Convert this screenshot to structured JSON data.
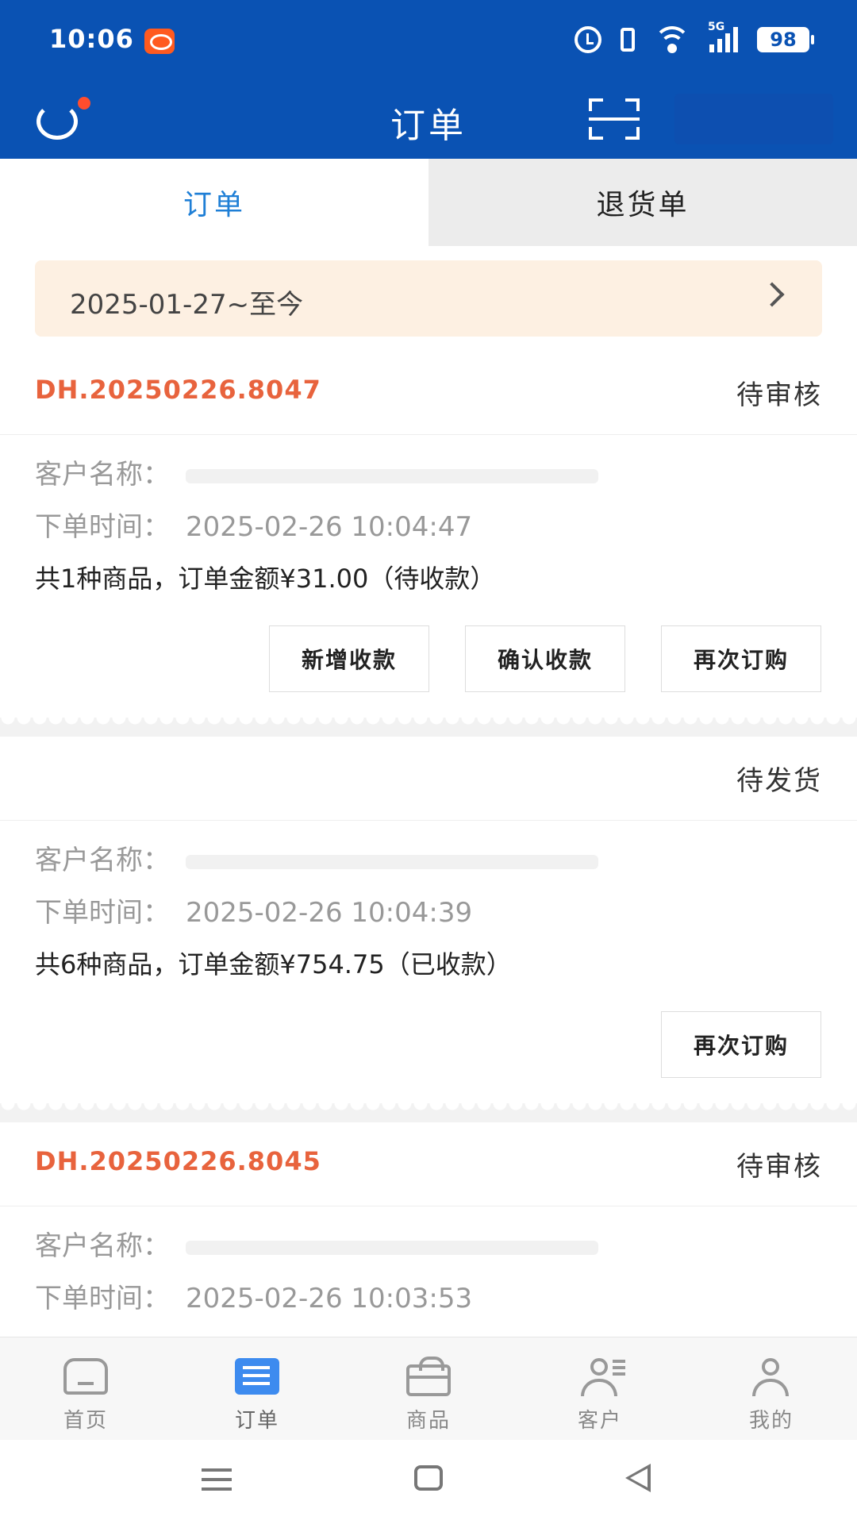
{
  "status_bar": {
    "time": "10:06",
    "network": "5G",
    "battery": "98"
  },
  "header": {
    "title": "订单"
  },
  "tabs": [
    {
      "label": "订单",
      "active": true
    },
    {
      "label": "退货单",
      "active": false
    }
  ],
  "date_filter": {
    "label": "2025-01-27~至今"
  },
  "labels": {
    "customer": "客户名称：",
    "order_time": "下单时间："
  },
  "orders": [
    {
      "order_no": "DH.20250226.8047",
      "status": "待审核",
      "time": "2025-02-26 10:04:47",
      "summary": "共1种商品，订单金额¥31.00（待收款）",
      "buttons": [
        "新增收款",
        "确认收款",
        "再次订购"
      ]
    },
    {
      "order_no": "",
      "status": "待发货",
      "time": "2025-02-26 10:04:39",
      "summary": "共6种商品，订单金额¥754.75（已收款）",
      "buttons": [
        "再次订购"
      ]
    },
    {
      "order_no": "DH.20250226.8045",
      "status": "待审核",
      "time": "2025-02-26 10:03:53"
    }
  ],
  "bottom_nav": [
    {
      "label": "首页",
      "icon": "home-icon"
    },
    {
      "label": "订单",
      "icon": "order-icon",
      "active": true
    },
    {
      "label": "商品",
      "icon": "bag-icon"
    },
    {
      "label": "客户",
      "icon": "customer-icon"
    },
    {
      "label": "我的",
      "icon": "profile-icon"
    }
  ],
  "colors": {
    "primary": "#0a52b3",
    "accent": "#e8633d",
    "tab_active": "#1f7fd6",
    "date_bar_bg": "#fdf0e2"
  }
}
